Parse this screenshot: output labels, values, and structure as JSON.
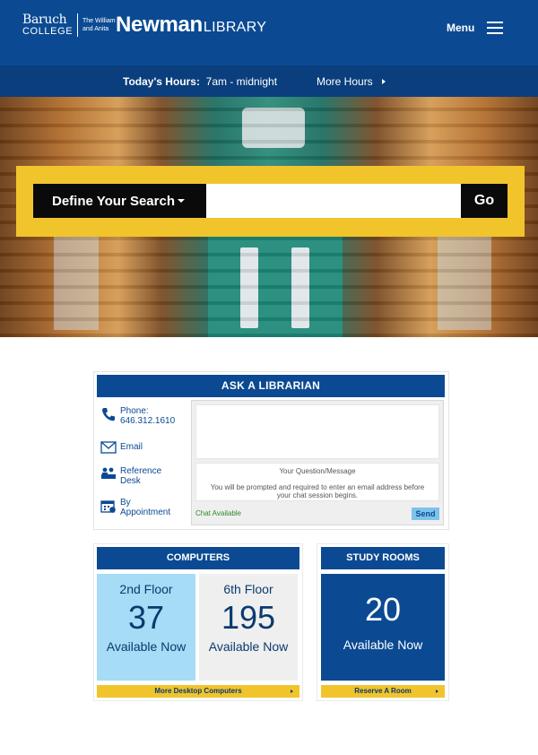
{
  "header": {
    "logo": {
      "baruch": "Baruch",
      "college": "COLLEGE",
      "the_william": "The William",
      "and_anita": "and Anita",
      "newman": "Newman",
      "library": "LIBRARY"
    },
    "menu_label": "Menu"
  },
  "hours": {
    "today_label": "Today's Hours:",
    "today_value": "7am - midnight",
    "more_hours": "More Hours"
  },
  "search": {
    "define_label": "Define Your Search",
    "input_value": "",
    "go_label": "Go"
  },
  "ask": {
    "title": "ASK A LIBRARIAN",
    "phone_label": "Phone:",
    "phone_number": "646.312.1610",
    "email": "Email",
    "reference_line1": "Reference",
    "reference_line2": "Desk",
    "appointment_line1": "By",
    "appointment_line2": "Appointment",
    "message_placeholder": "Your Question/Message",
    "message_note": "You will be prompted and required to enter an email address before your chat session begins.",
    "chat_status": "Chat Available",
    "send_label": "Send"
  },
  "computers": {
    "title": "COMPUTERS",
    "floors": [
      {
        "name": "2nd Floor",
        "count": "37",
        "status": "Available Now"
      },
      {
        "name": "6th Floor",
        "count": "195",
        "status": "Available Now"
      }
    ],
    "more_link": "More Desktop Computers"
  },
  "study_rooms": {
    "title": "STUDY ROOMS",
    "count": "20",
    "status": "Available Now",
    "reserve_link": "Reserve A Room"
  },
  "colors": {
    "brand_blue": "#0b4a93",
    "accent_yellow": "#f2c42c",
    "light_blue": "#a6dcf6"
  }
}
